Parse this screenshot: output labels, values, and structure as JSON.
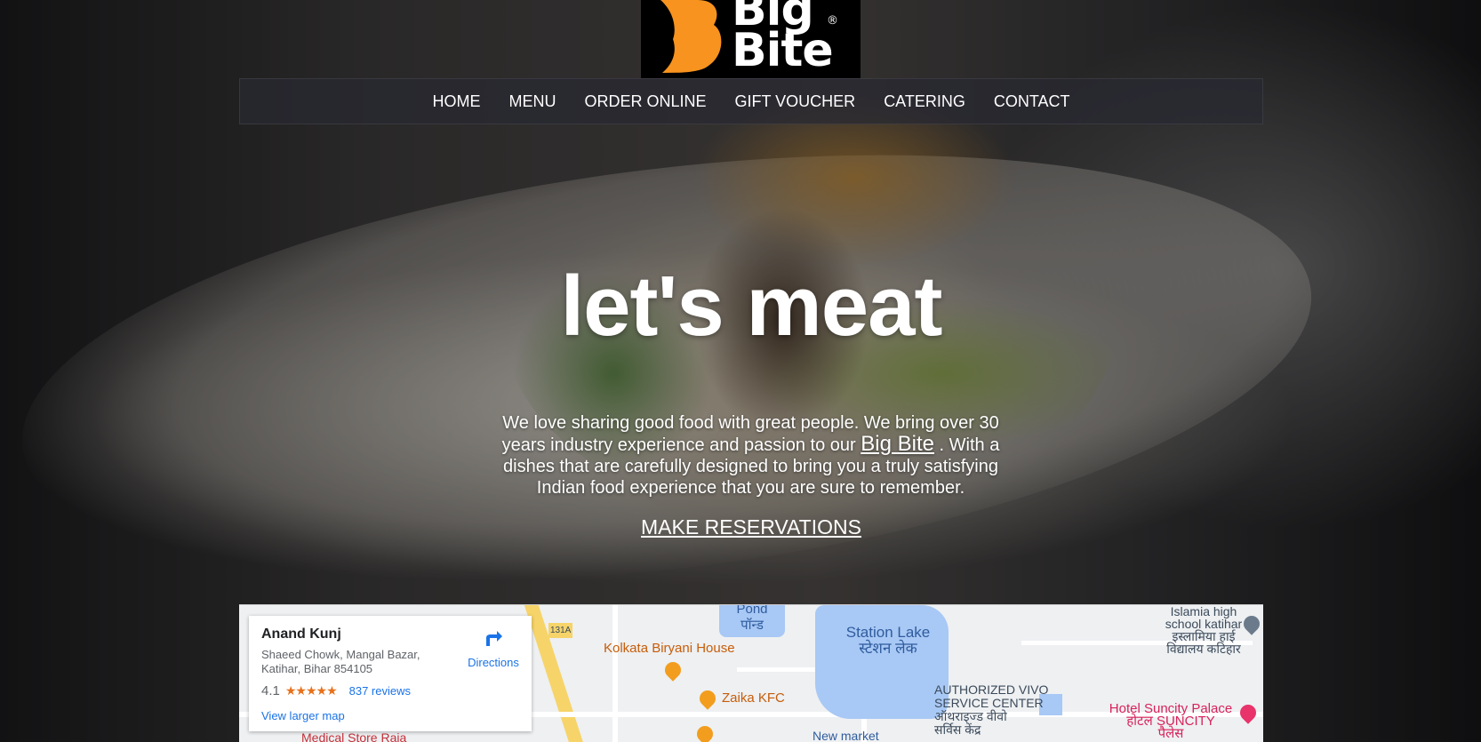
{
  "logo": {
    "line1": "Big",
    "line2": "Bite",
    "reg": "®",
    "brand_color": "#f7931e"
  },
  "nav": {
    "items": [
      "HOME",
      "MENU",
      "ORDER ONLINE",
      "GIFT VOUCHER",
      "CATERING",
      "CONTACT"
    ]
  },
  "hero": {
    "headline": "let's meat",
    "intro_before": "We love sharing good food with great people. We bring over 30 years industry experience and passion to our",
    "intro_link": "Big Bite",
    "intro_after": ". With a dishes that are carefully designed to bring you a truly satisfying Indian food experience that you are sure to remember.",
    "cta": "MAKE RESERVATIONS"
  },
  "map": {
    "place_name": "Anand Kunj",
    "address": "Shaeed Chowk, Mangal Bazar, Katihar, Bihar 854105",
    "rating": "4.1",
    "stars": "★★★★★",
    "reviews": "837 reviews",
    "directions": "Directions",
    "larger_map": "View larger map",
    "labels": {
      "pond": "Pond\nपॉन्ड",
      "station_lake": "Station Lake\nस्टेशन लेक",
      "islamia": "Islamia high\nschool katihar\nइस्लामिया हाई\nविद्यालय कटिहार",
      "kolkata_biryani": "Kolkata Biryani House",
      "zaika": "Zaika KFC",
      "vivo": "AUTHORIZED VIVO\nSERVICE CENTER\nऑथराइज्ड वीवो\nसर्विस केंद्र",
      "suncity": "Hotel Suncity Palace\nहोटल SUNCITY\nपैलेस",
      "new_market": "New market",
      "medical": "Medical Store Raja",
      "road_131a": "131A"
    }
  }
}
